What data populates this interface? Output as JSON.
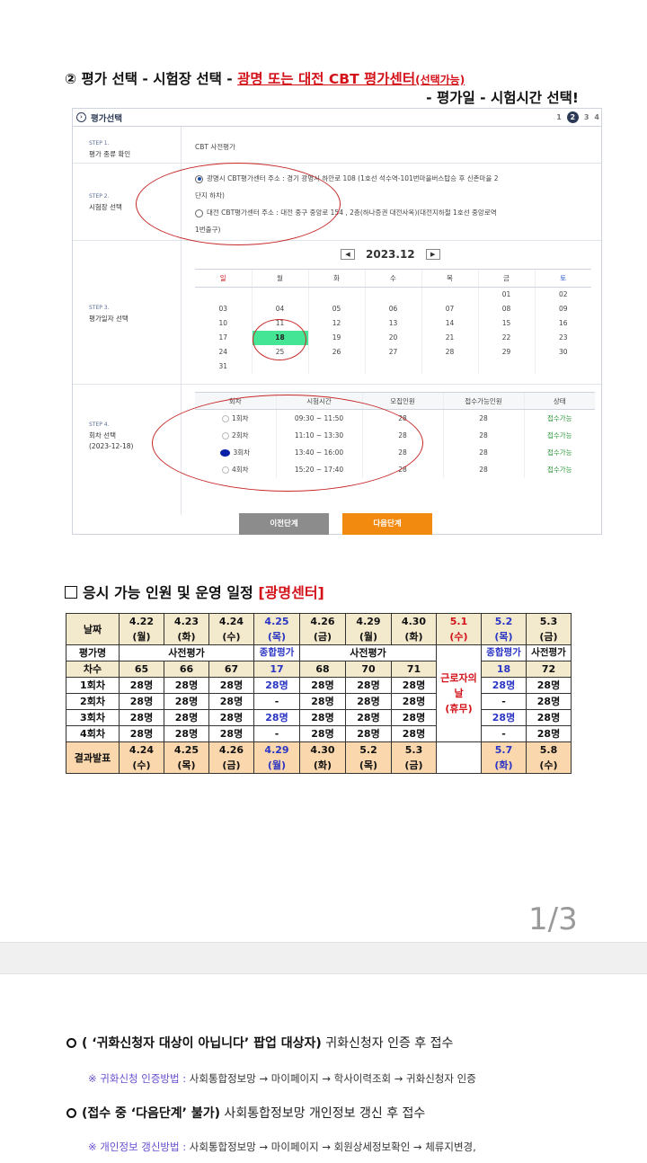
{
  "heading1": {
    "num": "②",
    "part1": "평가 선택 - 시험장 선택 - ",
    "red": "광명 또는 대전 CBT 평가센터",
    "red_small": "(선택가능)",
    "line2": "- 평가일 - 시험시간 선택!"
  },
  "form": {
    "title": "평가선택",
    "steps": [
      "1",
      "2",
      "3",
      "4"
    ],
    "step1": {
      "key": "STEP 1.",
      "label": "평가 종류 확인",
      "value": "CBT 사전평가"
    },
    "step2": {
      "key": "STEP 2.",
      "label": "시험장 선택",
      "option1": "광명시 CBT평가센터 주소 : 경기 광명시 하안로 108 (1호선 석수역-101번마을버스탑승 후 신촌마을 2",
      "option1b": "단지 하차)",
      "option2": "대전 CBT평가센터 주소 : 대전 중구 중앙로 154 , 2층(하나증권 대전사옥)(대전지하철 1호선 중앙로역",
      "option2b": "1번출구)"
    },
    "step3": {
      "key": "STEP 3.",
      "label": "평가일자 선택",
      "month": "2023.12",
      "prev": "◀",
      "next": "▶",
      "weekdays": [
        "일",
        "월",
        "화",
        "수",
        "목",
        "금",
        "토"
      ],
      "weeks": [
        [
          "",
          "",
          "",
          "",
          "",
          "01",
          "02"
        ],
        [
          "03",
          "04",
          "05",
          "06",
          "07",
          "08",
          "09"
        ],
        [
          "10",
          "11",
          "12",
          "13",
          "14",
          "15",
          "16"
        ],
        [
          "17",
          "18",
          "19",
          "20",
          "21",
          "22",
          "23"
        ],
        [
          "24",
          "25",
          "26",
          "27",
          "28",
          "29",
          "30"
        ],
        [
          "31",
          "",
          "",
          "",
          "",
          "",
          ""
        ]
      ]
    },
    "step4": {
      "key": "STEP 4.",
      "label": "회차 선택",
      "date": "(2023-12-18)",
      "headers": [
        "회차",
        "시험시간",
        "모집인원",
        "접수가능인원",
        "상태"
      ],
      "rows": [
        [
          "1회차",
          "09:30 ~ 11:50",
          "28",
          "28",
          "접수가능"
        ],
        [
          "2회차",
          "11:10 ~ 13:30",
          "28",
          "28",
          "접수가능"
        ],
        [
          "3회차",
          "13:40 ~ 16:00",
          "28",
          "28",
          "접수가능"
        ],
        [
          "4회차",
          "15:20 ~ 17:40",
          "28",
          "28",
          "접수가능"
        ]
      ]
    },
    "prev_button": "이전단계",
    "next_button": "다음단계"
  },
  "heading2": {
    "text": "응시 가능 인원 및 운영 일정 ",
    "red": "[광명센터]"
  },
  "schedule": {
    "date_label": "날짜",
    "dates": [
      [
        "4.22",
        "(월)"
      ],
      [
        "4.23",
        "(화)"
      ],
      [
        "4.24",
        "(수)"
      ],
      [
        "4.25",
        "(목)"
      ],
      [
        "4.26",
        "(금)"
      ],
      [
        "4.29",
        "(월)"
      ],
      [
        "4.30",
        "(화)"
      ],
      [
        "5.1",
        "(수)"
      ],
      [
        "5.2",
        "(목)"
      ],
      [
        "5.3",
        "(금)"
      ]
    ],
    "eval_label": "평가명",
    "pre_eval": "사전평가",
    "comp_eval": "종합평가",
    "pre_eval_short": "사전평가",
    "count_label": "차수",
    "counts": [
      "65",
      "66",
      "67",
      "17",
      "68",
      "70",
      "71",
      "18",
      "72"
    ],
    "sessions": [
      {
        "label": "1회차",
        "vals": [
          "28명",
          "28명",
          "28명",
          "28명",
          "28명",
          "28명",
          "28명",
          "28명",
          "28명"
        ]
      },
      {
        "label": "2회차",
        "vals": [
          "28명",
          "28명",
          "28명",
          "-",
          "28명",
          "28명",
          "28명",
          "-",
          "28명"
        ]
      },
      {
        "label": "3회차",
        "vals": [
          "28명",
          "28명",
          "28명",
          "28명",
          "28명",
          "28명",
          "28명",
          "28명",
          "28명"
        ]
      },
      {
        "label": "4회차",
        "vals": [
          "28명",
          "28명",
          "28명",
          "-",
          "28명",
          "28명",
          "28명",
          "-",
          "28명"
        ]
      }
    ],
    "holiday": "근로자의날",
    "holiday_sub": "(휴무)",
    "result_label": "결과발표",
    "results": [
      [
        "4.24",
        "(수)"
      ],
      [
        "4.25",
        "(목)"
      ],
      [
        "4.26",
        "(금)"
      ],
      [
        "4.29",
        "(월)"
      ],
      [
        "4.30",
        "(화)"
      ],
      [
        "5.2",
        "(목)"
      ],
      [
        "5.3",
        "(금)"
      ],
      [
        "5.7",
        "(화)"
      ],
      [
        "5.8",
        "(수)"
      ]
    ]
  },
  "page_indicator": "1/3",
  "notes": {
    "n1_bold": "( ‘귀화신청자 대상이 아닙니다’ 팝업 대상자)",
    "n1_rest": " 귀화신청자 인증 후 접수",
    "s1_hl": "※ 귀화신청 인증방법 : ",
    "s1_rest": "사회통합정보망 → 마이페이지 → 학사이력조회 → 귀화신청자 인증",
    "n2_bold": "(접수 중 ‘다음단계’ 불가)",
    "n2_rest": " 사회통합정보망 개인정보 갱신 후 접수",
    "s2_hl": "※ 개인정보 갱신방법 : ",
    "s2_rest": "사회통합정보망 → 마이페이지 → 회원상세정보확인 → 체류지변경,"
  }
}
